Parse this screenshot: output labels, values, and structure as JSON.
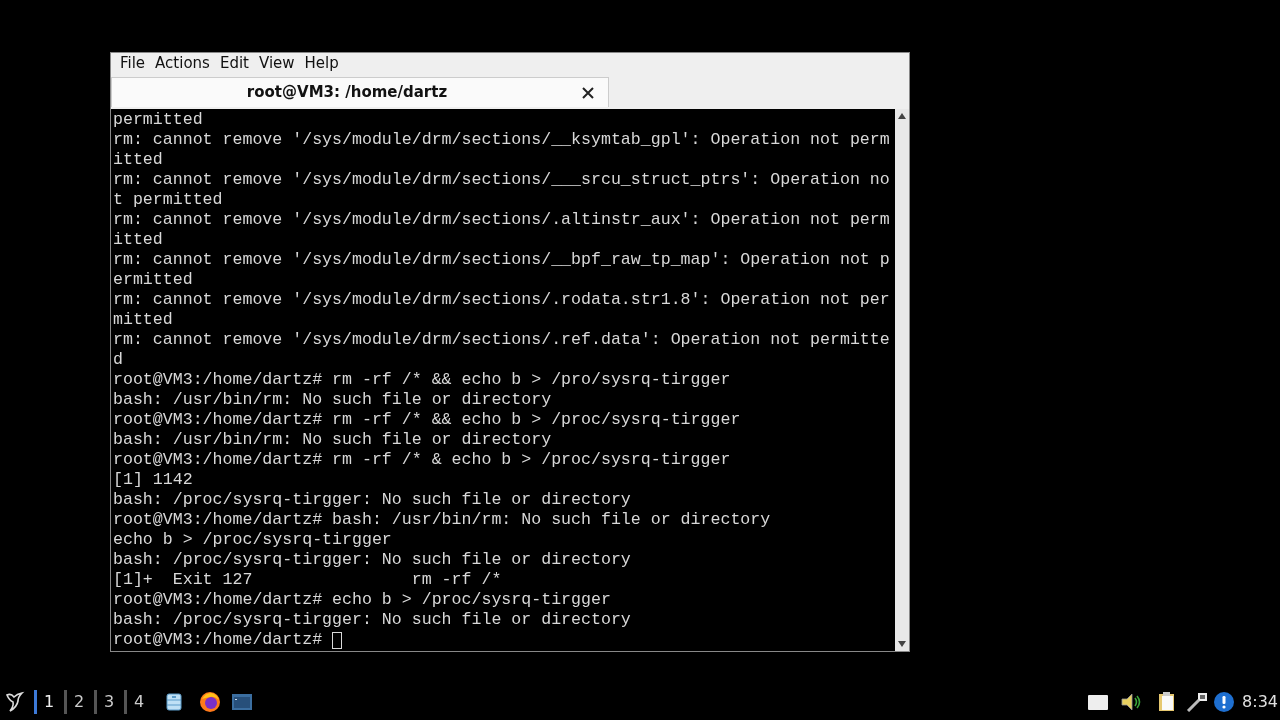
{
  "window": {
    "menu": [
      "File",
      "Actions",
      "Edit",
      "View",
      "Help"
    ],
    "tabs": [
      {
        "title": "root@VM3: /home/dartz",
        "selected": true
      }
    ],
    "terminal": {
      "lines": [
        "permitted",
        "rm: cannot remove '/sys/module/drm/sections/__ksymtab_gpl': Operation not perm",
        "itted",
        "rm: cannot remove '/sys/module/drm/sections/___srcu_struct_ptrs': Operation no",
        "t permitted",
        "rm: cannot remove '/sys/module/drm/sections/.altinstr_aux': Operation not perm",
        "itted",
        "rm: cannot remove '/sys/module/drm/sections/__bpf_raw_tp_map': Operation not p",
        "ermitted",
        "rm: cannot remove '/sys/module/drm/sections/.rodata.str1.8': Operation not per",
        "mitted",
        "rm: cannot remove '/sys/module/drm/sections/.ref.data': Operation not permitte",
        "d",
        "root@VM3:/home/dartz# rm -rf /* && echo b > /pro/sysrq-tirgger",
        "bash: /usr/bin/rm: No such file or directory",
        "root@VM3:/home/dartz# rm -rf /* && echo b > /proc/sysrq-tirgger",
        "bash: /usr/bin/rm: No such file or directory",
        "root@VM3:/home/dartz# rm -rf /* & echo b > /proc/sysrq-tirgger",
        "[1] 1142",
        "bash: /proc/sysrq-tirgger: No such file or directory",
        "root@VM3:/home/dartz# bash: /usr/bin/rm: No such file or directory",
        "echo b > /proc/sysrq-tirgger",
        "bash: /proc/sysrq-tirgger: No such file or directory",
        "[1]+  Exit 127                rm -rf /*",
        "root@VM3:/home/dartz# echo b > /proc/sysrq-tirgger",
        "bash: /proc/sysrq-tirgger: No such file or directory"
      ],
      "prompt": "root@VM3:/home/dartz# "
    }
  },
  "taskbar": {
    "workspaces": [
      {
        "label": "1",
        "selected": true
      },
      {
        "label": "2",
        "selected": false
      },
      {
        "label": "3",
        "selected": false
      },
      {
        "label": "4",
        "selected": false
      }
    ],
    "clock": "8:34"
  }
}
